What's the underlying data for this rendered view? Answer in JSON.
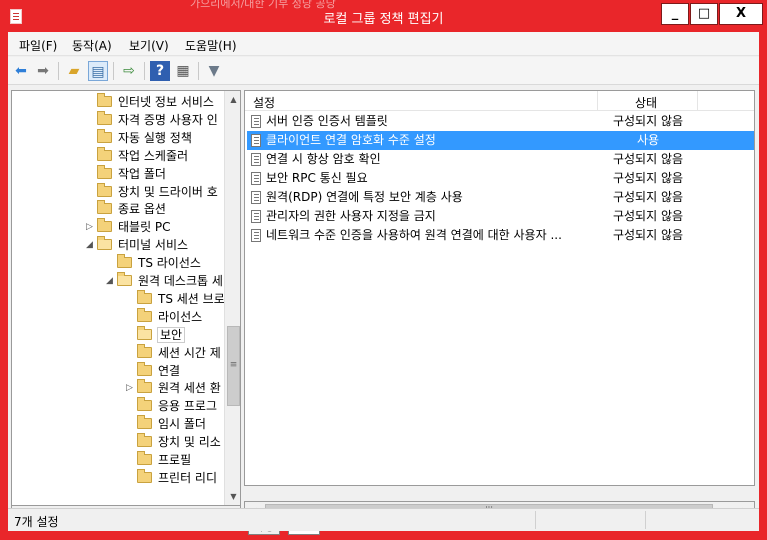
{
  "window": {
    "title": "로컬 그룹 정책 편집기",
    "title_ghost": "가으리에서/대한 기부 정당 공당",
    "buttons": {
      "minimize": "_",
      "maximize": "□",
      "close": "X"
    }
  },
  "menubar": {
    "items": [
      {
        "label": "파일(F)"
      },
      {
        "label": "동작(A)"
      },
      {
        "label": "보기(V)"
      },
      {
        "label": "도움말(H)"
      }
    ]
  },
  "toolbar": {
    "icons": [
      "back-icon",
      "forward-icon",
      "up-folder-icon",
      "show-hide-tree-icon",
      "export-icon",
      "help-icon",
      "properties-icon",
      "filter-icon"
    ]
  },
  "tree": {
    "items": [
      {
        "label": "인터넷 정보 서비스",
        "expander": ""
      },
      {
        "label": "자격 증명 사용자 인",
        "expander": ""
      },
      {
        "label": "자동 실행 정책",
        "expander": ""
      },
      {
        "label": "작업 스케줄러",
        "expander": ""
      },
      {
        "label": "작업 폴더",
        "expander": ""
      },
      {
        "label": "장치 및 드라이버 호",
        "expander": ""
      },
      {
        "label": "종료 옵션",
        "expander": ""
      },
      {
        "label": "태블릿 PC",
        "expander": "▷"
      },
      {
        "label": "터미널 서비스",
        "expander": "◢"
      },
      {
        "label": "TS 라이선스",
        "expander": ""
      },
      {
        "label": "원격 데스크톱 세",
        "expander": "◢"
      },
      {
        "label": "TS 세션 브로",
        "expander": ""
      },
      {
        "label": "라이선스",
        "expander": ""
      },
      {
        "label": "보안",
        "expander": ""
      },
      {
        "label": "세션 시간 제",
        "expander": ""
      },
      {
        "label": "연결",
        "expander": ""
      },
      {
        "label": "원격 세션 환",
        "expander": "▷"
      },
      {
        "label": "응용 프로그",
        "expander": ""
      },
      {
        "label": "임시 폴더",
        "expander": ""
      },
      {
        "label": "장치 및 리소",
        "expander": ""
      },
      {
        "label": "프로필",
        "expander": ""
      },
      {
        "label": "프린터 리디",
        "expander": ""
      }
    ]
  },
  "list": {
    "columns": {
      "setting": "설정",
      "state": "상태"
    },
    "rows": [
      {
        "name": "서버 인증 인증서 템플릿",
        "state": "구성되지 않음"
      },
      {
        "name": "클라이언트 연결 암호화 수준 설정",
        "state": "사용"
      },
      {
        "name": "연결 시 항상 암호 확인",
        "state": "구성되지 않음"
      },
      {
        "name": "보안 RPC 통신 필요",
        "state": "구성되지 않음"
      },
      {
        "name": "원격(RDP) 연결에 특정 보안 계층 사용",
        "state": "구성되지 않음"
      },
      {
        "name": "관리자의 권한 사용자 지정을 금지",
        "state": "구성되지 않음"
      },
      {
        "name": "네트워크 수준 인증을 사용하여 원격 연결에 대한 사용자 ...",
        "state": "구성되지 않음"
      }
    ]
  },
  "tabs": {
    "extended": "확장",
    "standard": "표준"
  },
  "statusbar": {
    "text": "7개 설정"
  },
  "colors": {
    "frame": "#e9262a",
    "selection": "#3399ff"
  }
}
